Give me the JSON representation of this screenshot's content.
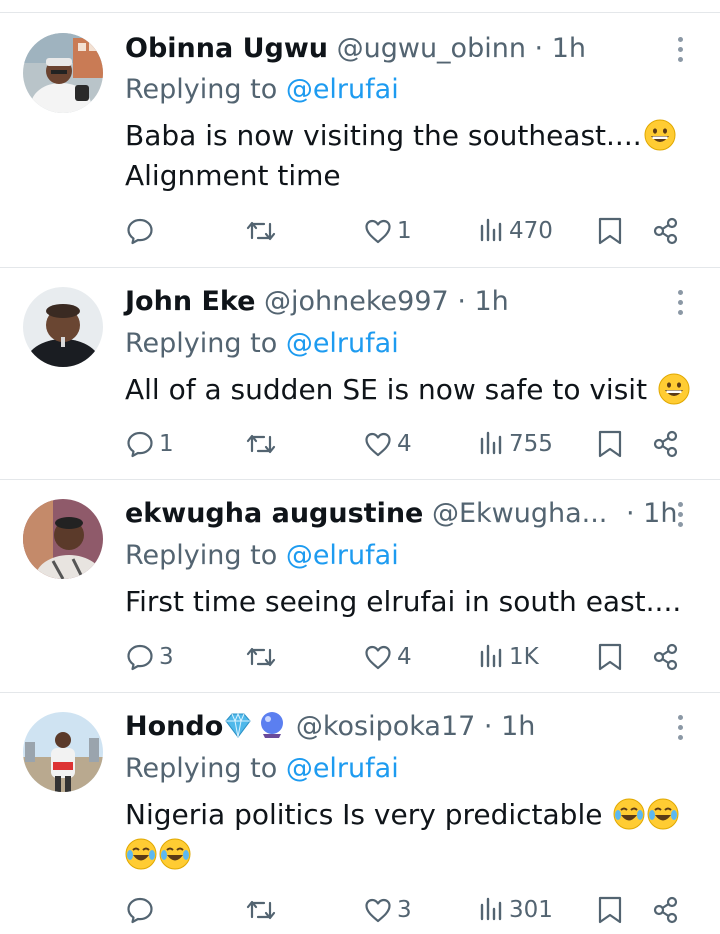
{
  "tweets": [
    {
      "name": "Obinna Ugwu",
      "handle": "@ugwu_obinn",
      "time": "1h",
      "replying_prefix": "Replying to",
      "replying_to": "@elrufai",
      "text_line1": "Baba is now visiting the southeast....",
      "text_line2": "Alignment time",
      "reply_count": "",
      "retweet_count": "",
      "like_count": "1",
      "view_count": "470"
    },
    {
      "name": "John Eke",
      "handle": "@johneke997",
      "time": "1h",
      "replying_prefix": "Replying to",
      "replying_to": "@elrufai",
      "text_line1": "All of a sudden SE is now safe to visit",
      "reply_count": "1",
      "retweet_count": "",
      "like_count": "4",
      "view_count": "755"
    },
    {
      "name": "ekwugha augustine",
      "handle": "@Ekwugha...",
      "time": "1h",
      "replying_prefix": "Replying to",
      "replying_to": "@elrufai",
      "text_line1": "First time seeing elrufai in south east....",
      "reply_count": "3",
      "retweet_count": "",
      "like_count": "4",
      "view_count": "1K"
    },
    {
      "name": "Hondo",
      "handle": "@kosipoka17",
      "time": "1h",
      "replying_prefix": "Replying to",
      "replying_to": "@elrufai",
      "text_line1": "Nigeria politics Is very predictable",
      "reply_count": "",
      "retweet_count": "",
      "like_count": "3",
      "view_count": "301"
    }
  ],
  "icons": {
    "reply": "reply-icon",
    "retweet": "retweet-icon",
    "like": "heart-icon",
    "views": "views-icon",
    "bookmark": "bookmark-icon",
    "share": "share-icon",
    "more": "more-icon"
  },
  "colors": {
    "text": "#0f1419",
    "secondary": "#536471",
    "link": "#1d9bf0",
    "divider": "#e4e7ea"
  }
}
